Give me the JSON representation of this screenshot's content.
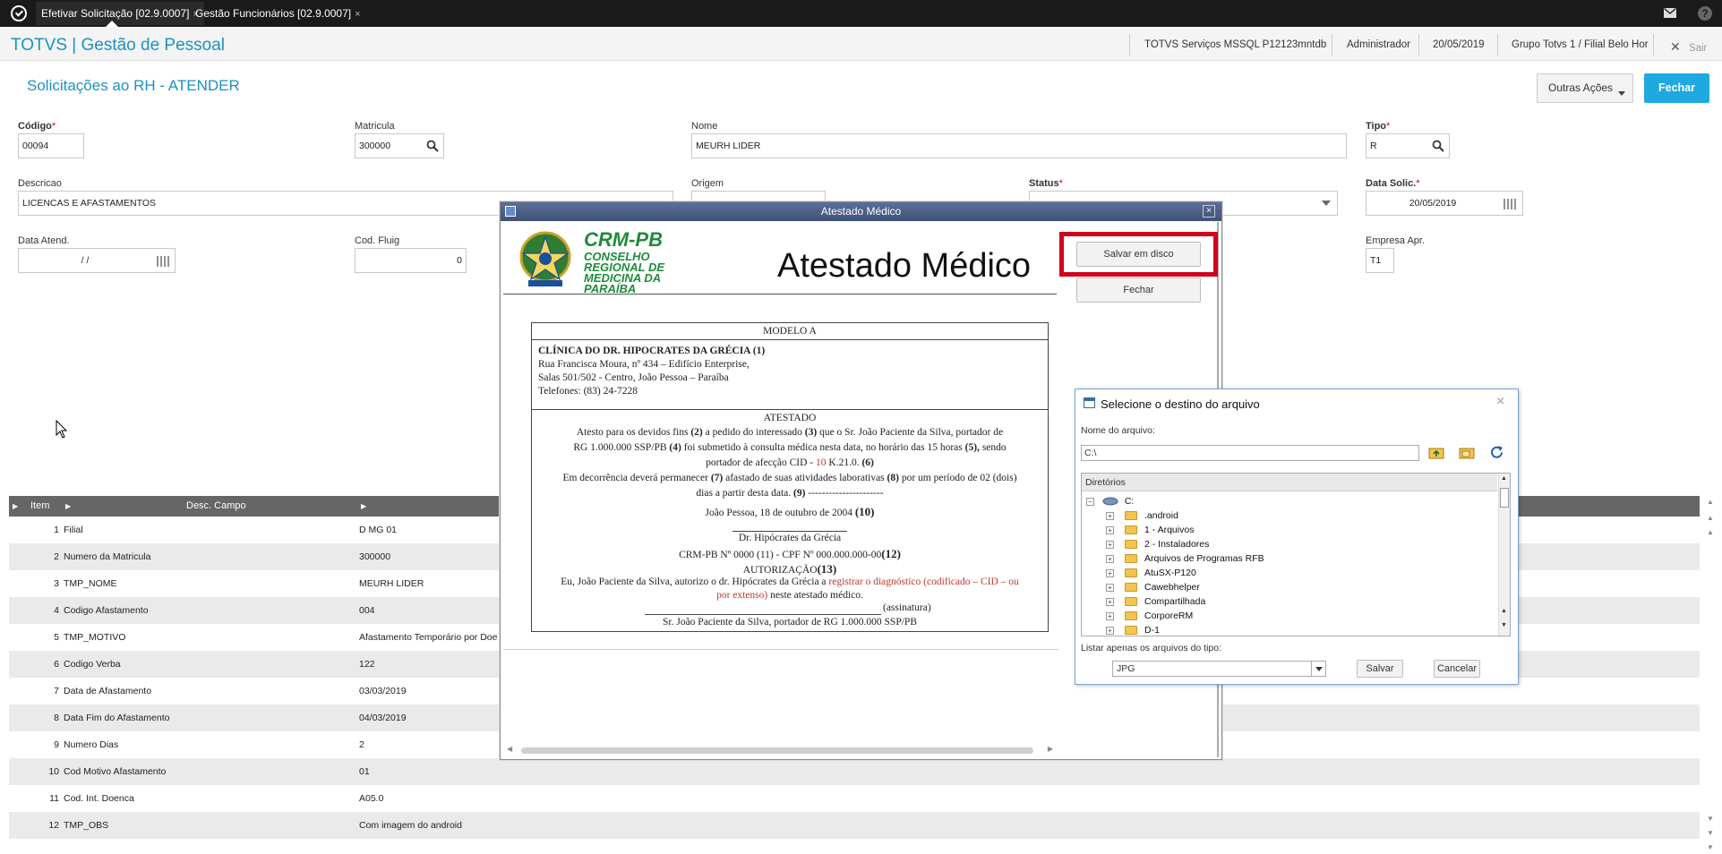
{
  "topbar": {
    "tabs": [
      {
        "label": "Efetivar Solicitação [02.9.0007]",
        "close": "×"
      },
      {
        "label": "Gestão Funcionários [02.9.0007]",
        "close": "×"
      }
    ],
    "icons": [
      "totvs-logo-icon",
      "mail-icon",
      "help-icon"
    ]
  },
  "header": {
    "app_title": "TOTVS | Gestão de Pessoal",
    "server": "TOTVS Serviços MSSQL P12123mntdb",
    "user": "Administrador",
    "date": "20/05/2019",
    "company": "Grupo Totvs 1 / Filial Belo Hor",
    "exit_label": "Sair"
  },
  "page": {
    "title": "Solicitações ao RH - ATENDER",
    "outras_acoes": "Outras Ações",
    "fechar": "Fechar"
  },
  "form": {
    "codigo_label": "Código",
    "codigo": "00094",
    "matricula_label": "Matricula",
    "matricula": "300000",
    "nome_label": "Nome",
    "nome": "MEURH LIDER",
    "tipo_label": "Tipo",
    "tipo": "R",
    "descricao_label": "Descricao",
    "descricao": "LICENCAS E AFASTAMENTOS",
    "origem_label": "Origem",
    "status_label": "Status",
    "data_solic_label": "Data Solic.",
    "data_solic": "20/05/2019",
    "data_atend_label": "Data Atend.",
    "data_atend": " / /",
    "cod_fluig_label": "Cod. Fluig",
    "cod_fluig": "0",
    "empresa_apr_label": "Empresa Apr.",
    "empresa_apr": "T1",
    "required_mark": "*"
  },
  "grid": {
    "headers": [
      "Item",
      "Desc. Campo"
    ],
    "rows": [
      {
        "item": "1",
        "campo": "Filial",
        "valor": "D MG 01"
      },
      {
        "item": "2",
        "campo": "Numero da Matricula",
        "valor": "300000"
      },
      {
        "item": "3",
        "campo": "TMP_NOME",
        "valor": "MEURH LIDER"
      },
      {
        "item": "4",
        "campo": "Codigo Afastamento",
        "valor": "004"
      },
      {
        "item": "5",
        "campo": "TMP_MOTIVO",
        "valor": "Afastamento Temporário por Doe"
      },
      {
        "item": "6",
        "campo": "Codigo Verba",
        "valor": "122"
      },
      {
        "item": "7",
        "campo": "Data de Afastamento",
        "valor": "03/03/2019"
      },
      {
        "item": "8",
        "campo": "Data Fim do Afastamento",
        "valor": "04/03/2019"
      },
      {
        "item": "9",
        "campo": "Numero Dias",
        "valor": "2"
      },
      {
        "item": "10",
        "campo": "Cod Motivo Afastamento",
        "valor": "01"
      },
      {
        "item": "11",
        "campo": "Cod. Int. Doenca",
        "valor": "A05.0"
      },
      {
        "item": "12",
        "campo": "TMP_OBS",
        "valor": "Com imagem do android"
      }
    ]
  },
  "atestado_dialog": {
    "title": "Atestado Médico",
    "close": "×",
    "salvar_em_disco": "Salvar em disco",
    "fechar": "Fechar",
    "doc": {
      "crm_abbrev": "CRM-PB",
      "crm_name_1": "CONSELHO",
      "crm_name_2": "REGIONAL DE",
      "crm_name_3": "MEDICINA DA",
      "crm_name_4": "PARAÍBA",
      "heading": "Atestado Médico",
      "modelo": "MODELO A",
      "clinica": "CLÍNICA DO DR. HIPOCRATES DA GRÉCIA",
      "clinica_ref": "(1)",
      "endereco1": "Rua Francisca Moura, nº 434 – Edifício Enterprise,",
      "endereco2": "Salas 501/502 -  Centro, João Pessoa – Paraíba",
      "telefones": "Telefones: (83) 24-7228",
      "atestado_head": "ATESTADO",
      "p1a": "Atesto para os devidos fins",
      "p1b": "(2)",
      "p1c": "a pedido do interessado",
      "p1d": "(3)",
      "p1e": "que o Sr. João Paciente da Silva, portador de",
      "p2a": "RG 1.000.000 SSP/PB",
      "p2b": "(4)",
      "p2c": "foi submetido à consulta médica nesta data, no horário das 15 horas",
      "p2d": "(5),",
      "p2e": "sendo",
      "p3a": "portador de afecção CID -",
      "p3b": "10",
      "p3c": "K.21.0.",
      "p3d": "(6)",
      "p4a": "Em decorrência deverá permanecer",
      "p4b": "(7)",
      "p4c": "afastado de suas atividades laborativas",
      "p4d": "(8)",
      "p4e": "por um período de 02 (dois)",
      "p5a": "dias a partir desta data.",
      "p5b": "(9)",
      "p5c": "----------------------",
      "p6a": "João Pessoa, 18 de outubro de 2004",
      "p6b": "(10)",
      "sign1": "Dr. Hipócrates da Grécia",
      "crm_line_a": "CRM-PB Nº 0000 (11)  -  CPF Nº 000.000.000-00",
      "crm_line_b": "(12)",
      "autorizacao": "AUTORIZAÇÃO",
      "autorizacao_ref": "(13)",
      "aut1a": "Eu, João Paciente da Silva, autorizo o dr. Hipócrates da Grécia a",
      "aut1b": "registrar o diagnóstico (codificado – CID – ou",
      "aut2a": "por extenso)",
      "aut2b": "neste atestado médico.",
      "assinatura": "(assinatura)",
      "sign2": "Sr. João Paciente da Silva, portador de RG 1.000.000 SSP/PB"
    }
  },
  "file_dialog": {
    "title": "Selecione o destino do arquivo",
    "close": "×",
    "nome_label": "Nome do arquivo:",
    "nome_value": "C:\\",
    "diretorios_label": "Diretórios",
    "root": "C:",
    "folders": [
      ".android",
      "1 - Arquivos",
      "2 - Instaladores",
      "Arquivos de Programas RFB",
      "AtuSX-P120",
      "Cawebhelper",
      "Compartilhada",
      "CorporeRM",
      "D-1"
    ],
    "tipo_label": "Listar apenas os arquivos do tipo:",
    "tipo_value": "JPG",
    "salvar": "Salvar",
    "cancelar": "Cancelar"
  }
}
